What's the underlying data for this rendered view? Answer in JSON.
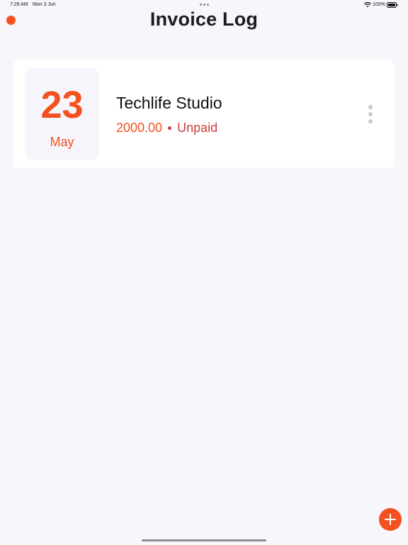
{
  "status_bar": {
    "time": "7:29 AM",
    "date": "Mon 3 Jun",
    "battery": "100%"
  },
  "header": {
    "title": "Invoice Log"
  },
  "invoices": [
    {
      "day": "23",
      "month": "May",
      "client": "Techlife Studio",
      "amount": "2000.00",
      "status": "Unpaid"
    }
  ],
  "colors": {
    "accent": "#f4511e",
    "unpaid": "#c73f3f",
    "background": "#f7f6fb",
    "card": "#ffffff"
  },
  "icons": {
    "menu": "menu-dot-icon",
    "more": "more-vertical-icon",
    "add": "plus-icon",
    "wifi": "wifi-icon",
    "battery": "battery-icon"
  }
}
